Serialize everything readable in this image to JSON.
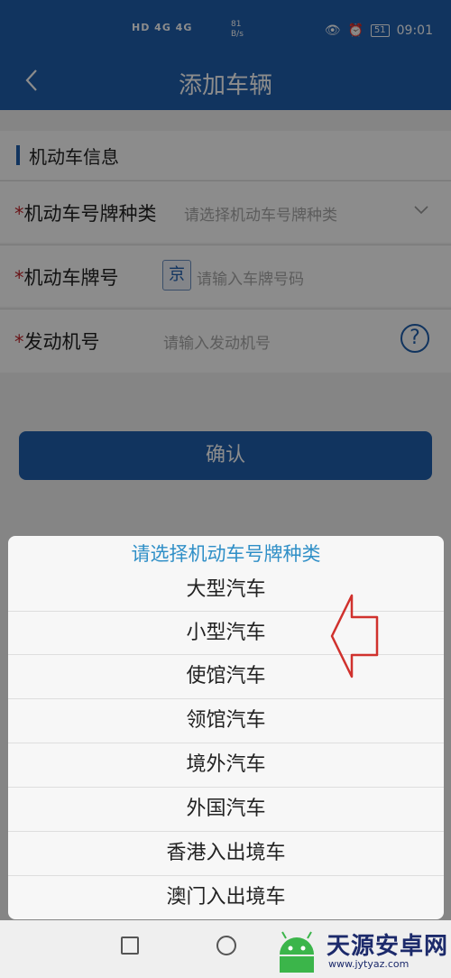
{
  "status_bar": {
    "net": "HD 4G 4G",
    "speed_value": "81",
    "speed_unit": "B/s",
    "battery": "51",
    "time": "09:01"
  },
  "header": {
    "title": "添加车辆"
  },
  "form": {
    "section_title": "机动车信息",
    "plate_type": {
      "required_mark": "*",
      "label": "机动车号牌种类",
      "placeholder": "请选择机动车号牌种类"
    },
    "plate_number": {
      "required_mark": "*",
      "label": "机动车牌号",
      "province": "京",
      "placeholder": "请输入车牌号码"
    },
    "engine_number": {
      "required_mark": "*",
      "label": "发动机号",
      "placeholder": "请输入发动机号",
      "help": "?"
    },
    "confirm_label": "确认"
  },
  "picker": {
    "title": "请选择机动车号牌种类",
    "options": [
      "大型汽车",
      "小型汽车",
      "使馆汽车",
      "领馆汽车",
      "境外汽车",
      "外国汽车",
      "香港入出境车",
      "澳门入出境车"
    ]
  },
  "watermark": {
    "name": "天源安卓网",
    "url": "www.jytyaz.com"
  },
  "colors": {
    "brand": "#1f5fae",
    "required": "#c0262c",
    "picker_title": "#2f8fc7",
    "arrow": "#d0312d"
  }
}
